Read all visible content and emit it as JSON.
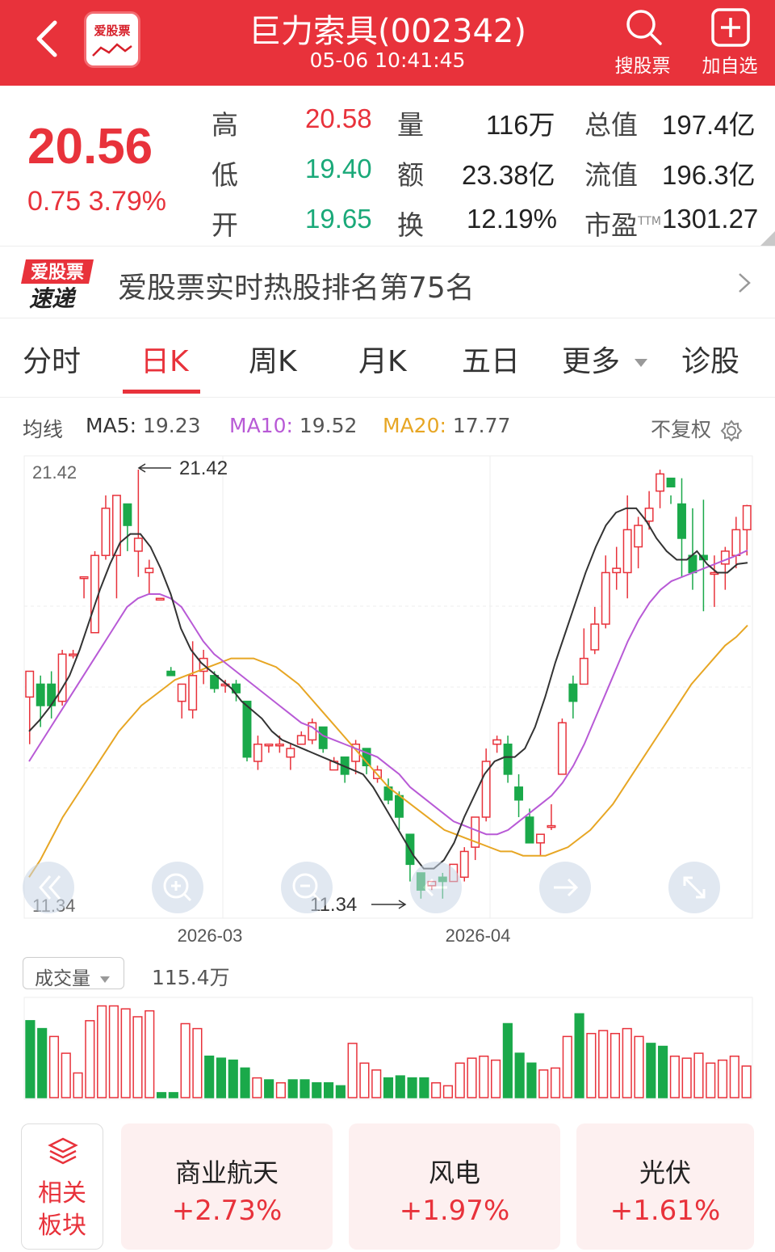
{
  "header": {
    "title": "巨力索具(002342)",
    "subtitle": "05-06 10:41:45",
    "logo_text": "爱股票",
    "search_label": "搜股票",
    "add_label": "加自选"
  },
  "quote": {
    "price": "20.56",
    "change": "0.75  3.79%",
    "rows": [
      {
        "l1": "高",
        "v1": "20.58",
        "l2": "量",
        "v2": "116万",
        "l3": "总值",
        "v3": "197.4亿"
      },
      {
        "l1": "低",
        "v1": "19.40",
        "l2": "额",
        "v2": "23.38亿",
        "l3": "流值",
        "v3": "196.3亿"
      },
      {
        "l1": "开",
        "v1": "19.65",
        "l2": "换",
        "v2": "12.19%",
        "l3": "市盈",
        "l3sup": "TTM",
        "v3": "1301.27"
      }
    ]
  },
  "hot": {
    "logo_line1": "爱股票",
    "logo_line2": "速递",
    "text": "爱股票实时热股排名第75名"
  },
  "tabs": [
    "分时",
    "日K",
    "周K",
    "月K",
    "五日",
    "更多",
    "诊股"
  ],
  "ma": {
    "label": "均线",
    "ma5_label": "MA5:",
    "ma5": "19.23",
    "ma10_label": "MA10:",
    "ma10": "19.52",
    "ma20_label": "MA20:",
    "ma20": "17.77",
    "adjust": "不复权"
  },
  "colors": {
    "up": "#e8323b",
    "down": "#1aa94a",
    "ma5": "#333333",
    "ma10": "#b85ad6",
    "ma20": "#e7a624"
  },
  "chart_data": {
    "type": "candlestick",
    "y_max_label": "21.42",
    "y_min_label": "11.34",
    "high_annotation": "21.42",
    "low_annotation": "11.34",
    "x_ticks": [
      "2026-03",
      "2026-04"
    ],
    "ylim": [
      11.34,
      21.42
    ],
    "candles": [
      [
        16.1,
        16.7,
        15.0,
        16.4
      ],
      [
        16.4,
        15.9,
        15.4,
        16.6
      ],
      [
        16.4,
        15.9,
        15.6,
        16.7
      ],
      [
        16.0,
        17.1,
        15.9,
        17.2
      ],
      [
        17.1,
        17.1,
        17.0,
        17.2
      ],
      [
        18.9,
        18.9,
        18.4,
        18.9
      ],
      [
        17.6,
        19.4,
        17.6,
        19.5
      ],
      [
        19.4,
        20.5,
        19.3,
        20.8
      ],
      [
        19.4,
        20.8,
        18.4,
        20.8
      ],
      [
        20.6,
        20.1,
        19.5,
        20.2
      ],
      [
        19.5,
        19.8,
        18.9,
        21.4
      ],
      [
        19.0,
        19.1,
        18.5,
        19.3
      ],
      [
        18.4,
        18.4,
        18.4,
        18.4
      ],
      [
        16.7,
        16.6,
        16.6,
        16.8
      ],
      [
        16.0,
        16.4,
        15.6,
        16.4
      ],
      [
        15.8,
        16.6,
        15.6,
        17.4
      ],
      [
        16.7,
        17.0,
        16.4,
        17.2
      ],
      [
        16.6,
        16.3,
        16.2,
        16.7
      ],
      [
        16.4,
        16.4,
        16.2,
        16.5
      ],
      [
        16.4,
        16.2,
        16.0,
        16.5
      ],
      [
        16.0,
        14.7,
        14.6,
        16.0
      ],
      [
        14.6,
        15.0,
        14.4,
        15.2
      ],
      [
        15.0,
        15.0,
        14.8,
        15.0
      ],
      [
        15.0,
        15.0,
        14.8,
        15.2
      ],
      [
        14.7,
        14.9,
        14.4,
        15.0
      ],
      [
        15.0,
        15.2,
        15.0,
        15.3
      ],
      [
        15.1,
        15.5,
        15.0,
        15.6
      ],
      [
        15.4,
        14.9,
        14.8,
        15.4
      ],
      [
        14.4,
        14.6,
        14.4,
        14.7
      ],
      [
        14.7,
        14.3,
        14.1,
        14.7
      ],
      [
        14.6,
        15.0,
        14.3,
        15.1
      ],
      [
        14.9,
        14.5,
        14.3,
        14.8
      ],
      [
        14.2,
        14.4,
        14.1,
        14.5
      ],
      [
        14.0,
        13.7,
        13.6,
        14.2
      ],
      [
        13.8,
        13.3,
        13.0,
        13.9
      ],
      [
        12.9,
        12.2,
        11.8,
        12.9
      ],
      [
        12.0,
        11.6,
        11.4,
        12.0
      ],
      [
        11.7,
        11.8,
        11.6,
        11.8
      ],
      [
        11.9,
        11.8,
        11.4,
        12.0
      ],
      [
        11.8,
        12.2,
        11.9,
        12.1
      ],
      [
        11.9,
        12.5,
        11.8,
        12.6
      ],
      [
        12.6,
        13.3,
        12.3,
        13.3
      ],
      [
        13.3,
        14.6,
        13.2,
        14.9
      ],
      [
        15.0,
        15.1,
        14.8,
        15.2
      ],
      [
        15.0,
        14.3,
        14.1,
        15.2
      ],
      [
        14.0,
        13.7,
        13.3,
        14.3
      ],
      [
        13.3,
        12.7,
        12.7,
        13.5
      ],
      [
        12.7,
        12.9,
        12.4,
        12.9
      ],
      [
        13.1,
        13.1,
        13.0,
        13.6
      ],
      [
        14.3,
        15.5,
        14.3,
        15.6
      ],
      [
        16.4,
        16.0,
        15.6,
        16.6
      ],
      [
        16.4,
        17.0,
        16.4,
        17.7
      ],
      [
        17.2,
        17.8,
        17.1,
        18.2
      ],
      [
        17.8,
        19.0,
        17.7,
        19.4
      ],
      [
        19.0,
        19.1,
        18.6,
        19.6
      ],
      [
        19.0,
        20.0,
        18.4,
        20.8
      ],
      [
        19.6,
        20.1,
        19.1,
        20.3
      ],
      [
        20.2,
        20.5,
        20.0,
        20.9
      ],
      [
        20.9,
        21.3,
        20.5,
        21.4
      ],
      [
        21.2,
        21.0,
        20.6,
        20.8
      ],
      [
        20.6,
        19.8,
        18.9,
        21.2
      ],
      [
        19.4,
        19.0,
        18.6,
        20.5
      ],
      [
        19.4,
        19.3,
        18.1,
        20.7
      ],
      [
        19.0,
        19.0,
        18.2,
        19.4
      ],
      [
        19.2,
        19.5,
        18.6,
        19.6
      ],
      [
        19.4,
        20.0,
        19.1,
        20.3
      ],
      [
        20.0,
        20.56,
        19.4,
        20.58
      ]
    ],
    "ma5": [
      15.3,
      15.55,
      15.85,
      16.2,
      16.6,
      17.2,
      17.9,
      18.6,
      19.2,
      19.7,
      19.9,
      19.9,
      19.6,
      19.1,
      18.5,
      17.7,
      17.2,
      16.9,
      16.7,
      16.5,
      16.3,
      16.0,
      15.8,
      15.6,
      15.3,
      15.1,
      15.0,
      14.9,
      14.8,
      14.7,
      14.6,
      14.5,
      14.4,
      14.3,
      14.0,
      13.6,
      13.2,
      12.8,
      12.4,
      12.1,
      12.1,
      12.3,
      12.7,
      13.3,
      13.8,
      14.3,
      14.6,
      14.7,
      14.7,
      14.9,
      15.4,
      16.1,
      16.9,
      17.6,
      18.3,
      19.0,
      19.6,
      20.1,
      20.4,
      20.5,
      20.5,
      20.2,
      19.8,
      19.5,
      19.3,
      19.3,
      19.5,
      19.2,
      19.0,
      19.0,
      19.2,
      19.23
    ],
    "ma10": [
      14.6,
      15.0,
      15.4,
      15.8,
      16.2,
      16.6,
      17.0,
      17.4,
      17.8,
      18.2,
      18.4,
      18.5,
      18.5,
      18.4,
      18.2,
      17.8,
      17.4,
      17.1,
      16.9,
      16.7,
      16.5,
      16.3,
      16.1,
      15.9,
      15.7,
      15.5,
      15.4,
      15.2,
      15.1,
      15.0,
      14.9,
      14.8,
      14.7,
      14.5,
      14.3,
      14.0,
      13.8,
      13.6,
      13.4,
      13.2,
      13.1,
      13.0,
      12.9,
      12.9,
      13.0,
      13.2,
      13.4,
      13.6,
      13.8,
      14.1,
      14.5,
      15.0,
      15.6,
      16.2,
      16.8,
      17.4,
      17.9,
      18.3,
      18.6,
      18.8,
      18.9,
      19.0,
      19.1,
      19.2,
      19.3,
      19.4,
      19.52
    ],
    "ma20": [
      11.9,
      12.3,
      12.8,
      13.3,
      13.7,
      14.1,
      14.5,
      14.9,
      15.3,
      15.6,
      15.9,
      16.1,
      16.3,
      16.5,
      16.6,
      16.7,
      16.8,
      16.9,
      17.0,
      17.0,
      17.0,
      16.9,
      16.8,
      16.6,
      16.4,
      16.1,
      15.8,
      15.5,
      15.2,
      14.9,
      14.6,
      14.3,
      14.0,
      13.8,
      13.6,
      13.4,
      13.2,
      13.0,
      12.9,
      12.8,
      12.7,
      12.6,
      12.5,
      12.5,
      12.4,
      12.4,
      12.4,
      12.5,
      12.6,
      12.8,
      13.0,
      13.3,
      13.6,
      14.0,
      14.4,
      14.8,
      15.2,
      15.6,
      16.0,
      16.4,
      16.7,
      17.0,
      17.3,
      17.5,
      17.77
    ],
    "volume": {
      "label": "成交量",
      "value": "115.4万",
      "bars": [
        0.78,
        0.7,
        0.62,
        0.45,
        0.25,
        0.78,
        0.93,
        0.93,
        0.9,
        0.82,
        0.88,
        0.05,
        0.05,
        0.75,
        0.7,
        0.42,
        0.4,
        0.38,
        0.3,
        0.2,
        0.18,
        0.15,
        0.18,
        0.18,
        0.15,
        0.15,
        0.12,
        0.55,
        0.35,
        0.28,
        0.2,
        0.22,
        0.2,
        0.2,
        0.15,
        0.12,
        0.35,
        0.4,
        0.42,
        0.38,
        0.75,
        0.45,
        0.35,
        0.28,
        0.3,
        0.62,
        0.85,
        0.65,
        0.68,
        0.65,
        0.7,
        0.62,
        0.55,
        0.52,
        0.42,
        0.4,
        0.45,
        0.35,
        0.38,
        0.42,
        0.32
      ],
      "bar_up": [
        false,
        false,
        true,
        true,
        true,
        true,
        true,
        true,
        true,
        true,
        true,
        false,
        false,
        true,
        true,
        false,
        false,
        false,
        false,
        true,
        false,
        true,
        false,
        false,
        false,
        false,
        false,
        true,
        true,
        true,
        false,
        false,
        false,
        false,
        true,
        true,
        true,
        true,
        true,
        true,
        false,
        false,
        false,
        true,
        true,
        true,
        false,
        true,
        true,
        true,
        true,
        true,
        false,
        false,
        true,
        true,
        true,
        true,
        true,
        true,
        true
      ]
    }
  },
  "related": {
    "line1": "相关",
    "line2": "板块"
  },
  "sectors": [
    {
      "name": "商业航天",
      "pct": "+2.73%"
    },
    {
      "name": "风电",
      "pct": "+1.97%"
    },
    {
      "name": "光伏",
      "pct": "+1.61%"
    }
  ]
}
